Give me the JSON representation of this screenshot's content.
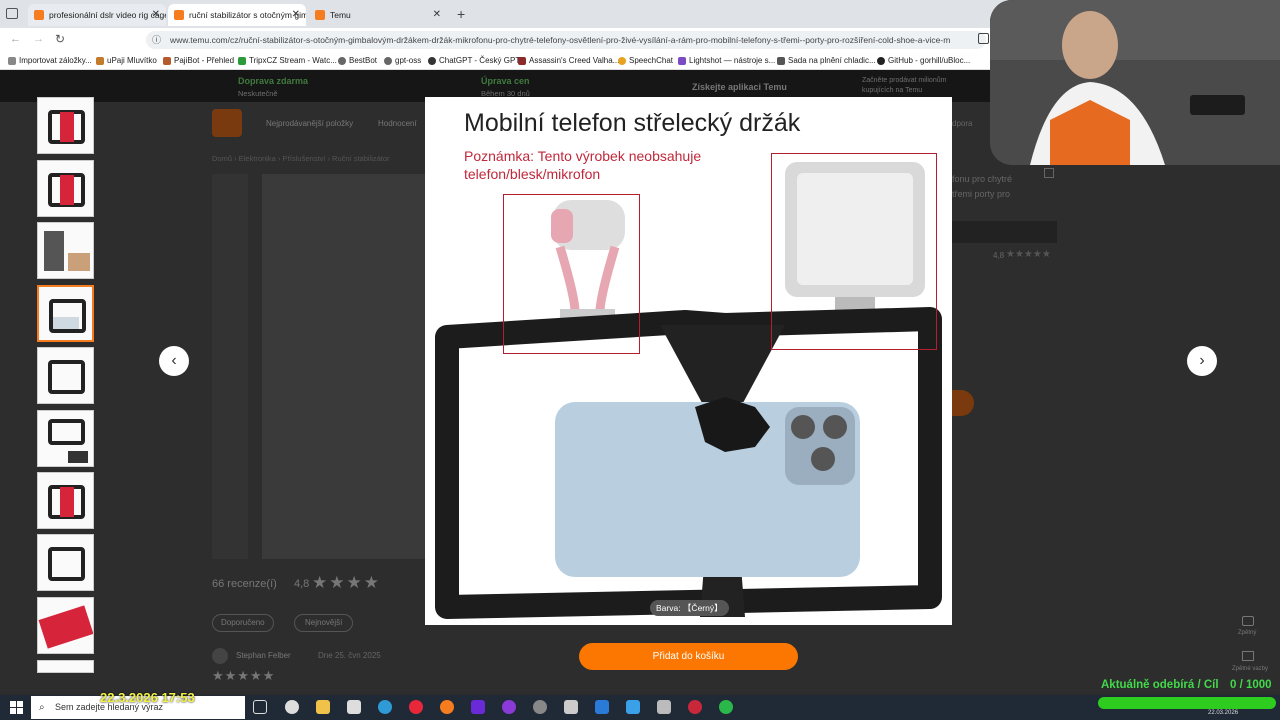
{
  "browser": {
    "tabs": [
      {
        "label": "profesionální dslr video rig cage"
      },
      {
        "label": "ruční stabilizátor s otočným gim"
      },
      {
        "label": "Temu"
      }
    ],
    "url": "www.temu.com/cz/ruční-stabilizátor-s-otočným-gimbalovým-držákem-držák-mikrofonu-pro-chytré-telefony-osvětlení-pro-živé-vysílání-a-rám-pro-mobilní-telefony-s-třemi--porty-pro-rozšíření-cold-shoe-a-vice-m",
    "bookmarks": [
      "Importovat záložky...",
      "uPaji Mluvítko",
      "PajiBot - Přehled",
      "TripxCZ Stream - Watc...",
      "BestBot",
      "gpt-oss",
      "ChatGPT - Český GPT",
      "Assassin's Creed Valha...",
      "SpeechChat",
      "Lightshot — nástroje s...",
      "Sada na plnění chladic...",
      "GitHub - gorhill/uBloc..."
    ]
  },
  "page": {
    "banner": {
      "shipping": "Doprava zdarma",
      "shipping_sub": "Neskutečně",
      "price_adjust": "Úprava cen",
      "price_adjust_sub": "Během 30 dnů",
      "app": "Získejte aplikaci Temu",
      "sell": "Začněte prodávat milionům kupujících na Temu"
    },
    "nav": {
      "bestsellers": "Nejprodávanější položky",
      "rated": "Hodnocení"
    },
    "breadcrumb": "Domů › Elektronika › Příslušenství › Ruční stabilizátor",
    "reviews": {
      "count_label": "66 recenze(í)",
      "rating": "4,8",
      "rating_small": "4,8",
      "filter_recommended": "Doporučeno",
      "filter_newest": "Nejnovější",
      "reviewer": "Stephan Felber",
      "review_date": "Dne 25. čvn 2025"
    },
    "side_text": "fonu pro chytré třemi porty pro",
    "side_extra": "dpora",
    "side_icons": [
      "Zpětný",
      "Zpětné vazby"
    ]
  },
  "modal": {
    "title": "Mobilní telefon střelecký držák",
    "note": "Poznámka: Tento výrobek neobsahuje telefon/blesk/mikrofon",
    "color_chip": "Barva: 【Černý】",
    "add_to_cart": "Přidat do košíku"
  },
  "taskbar": {
    "search_placeholder": "Sem zadejte hledaný výraz",
    "overlay_datetime": "22.3.2026 17:53",
    "clock_date": "22.03.2026"
  },
  "stream_overlay": {
    "sub_label": "Aktuálně odebírá / Cíl",
    "sub_count": "0 / 1000",
    "progress": 0
  },
  "colors": {
    "accent": "#fb7701",
    "note_red": "#c0283b",
    "progress_green": "#2ecc1f"
  }
}
